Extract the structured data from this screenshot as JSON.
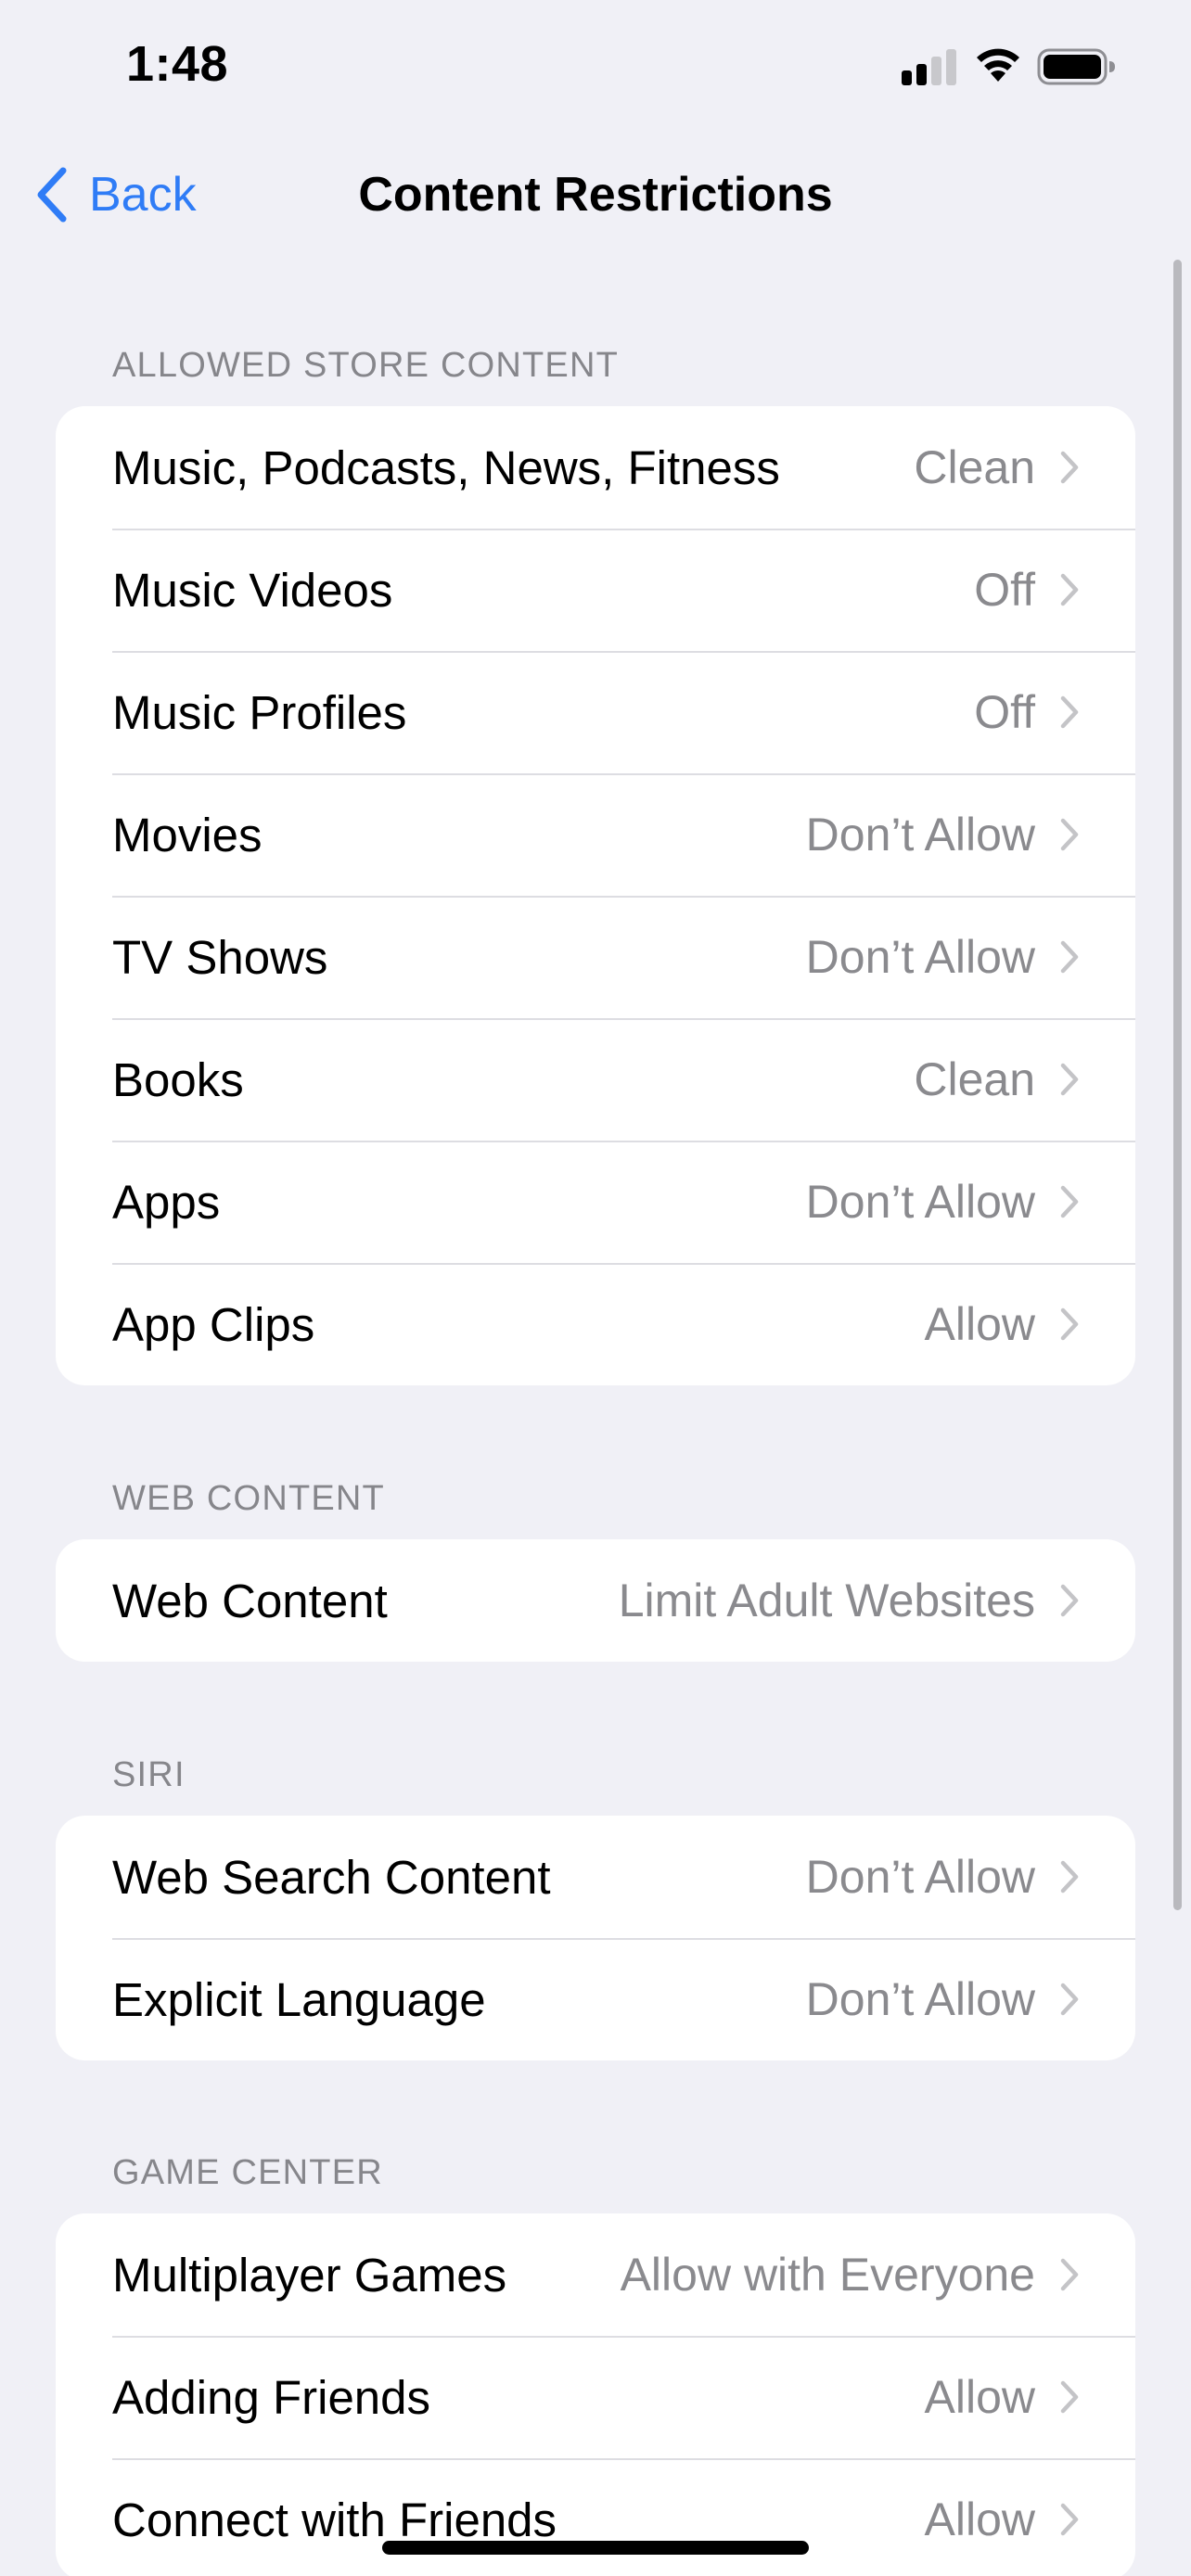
{
  "status_bar": {
    "time": "1:48",
    "signal_icon": "cellular-signal-icon",
    "wifi_icon": "wifi-icon",
    "battery_icon": "battery-icon",
    "signal_bars_active": 2
  },
  "nav": {
    "back_label": "Back",
    "title": "Content Restrictions",
    "accent_color": "#2F7CF6"
  },
  "sections": [
    {
      "header": "ALLOWED STORE CONTENT",
      "rows": [
        {
          "label": "Music, Podcasts, News, Fitness",
          "value": "Clean"
        },
        {
          "label": "Music Videos",
          "value": "Off"
        },
        {
          "label": "Music Profiles",
          "value": "Off"
        },
        {
          "label": "Movies",
          "value": "Don’t Allow"
        },
        {
          "label": "TV Shows",
          "value": "Don’t Allow"
        },
        {
          "label": "Books",
          "value": "Clean"
        },
        {
          "label": "Apps",
          "value": "Don’t Allow"
        },
        {
          "label": "App Clips",
          "value": "Allow"
        }
      ]
    },
    {
      "header": "WEB CONTENT",
      "rows": [
        {
          "label": "Web Content",
          "value": "Limit Adult Websites"
        }
      ]
    },
    {
      "header": "SIRI",
      "rows": [
        {
          "label": "Web Search Content",
          "value": "Don’t Allow"
        },
        {
          "label": "Explicit Language",
          "value": "Don’t Allow"
        }
      ]
    },
    {
      "header": "GAME CENTER",
      "rows": [
        {
          "label": "Multiplayer Games",
          "value": "Allow with Everyone"
        },
        {
          "label": "Adding Friends",
          "value": "Allow"
        },
        {
          "label": "Connect with Friends",
          "value": "Allow"
        }
      ]
    }
  ],
  "colors": {
    "background": "#F0F0F6",
    "card": "#FFFFFF",
    "secondary_text": "#8A8A8E",
    "section_header": "#86868B",
    "chevron": "#C4C4C7"
  }
}
